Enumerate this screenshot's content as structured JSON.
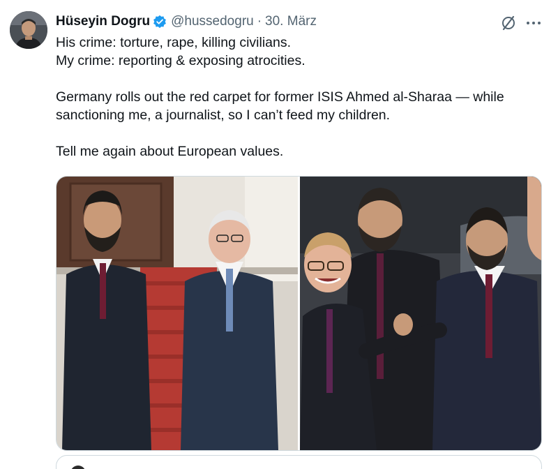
{
  "tweet": {
    "author": {
      "display_name": "Hüseyin Dogru",
      "handle": "@hussedogru",
      "verified_icon": "verified-badge-icon",
      "verified_color": "#1d9bf0"
    },
    "separator": "·",
    "date": "30. März",
    "lines": [
      "His crime: torture, rape, killing civilians.",
      "My crime: reporting & exposing atrocities.",
      "Germany rolls out the red carpet for former ISIS Ahmed al-Sharaa — while",
      "sanctioning me, a journalist, so I can’t feed my children.",
      "Tell me again about European values."
    ],
    "icons": {
      "grok": "grok-icon",
      "more": "more-options-icon"
    },
    "colors": {
      "text": "#0f1419",
      "secondary": "#536471",
      "border": "#cfd9de"
    }
  }
}
